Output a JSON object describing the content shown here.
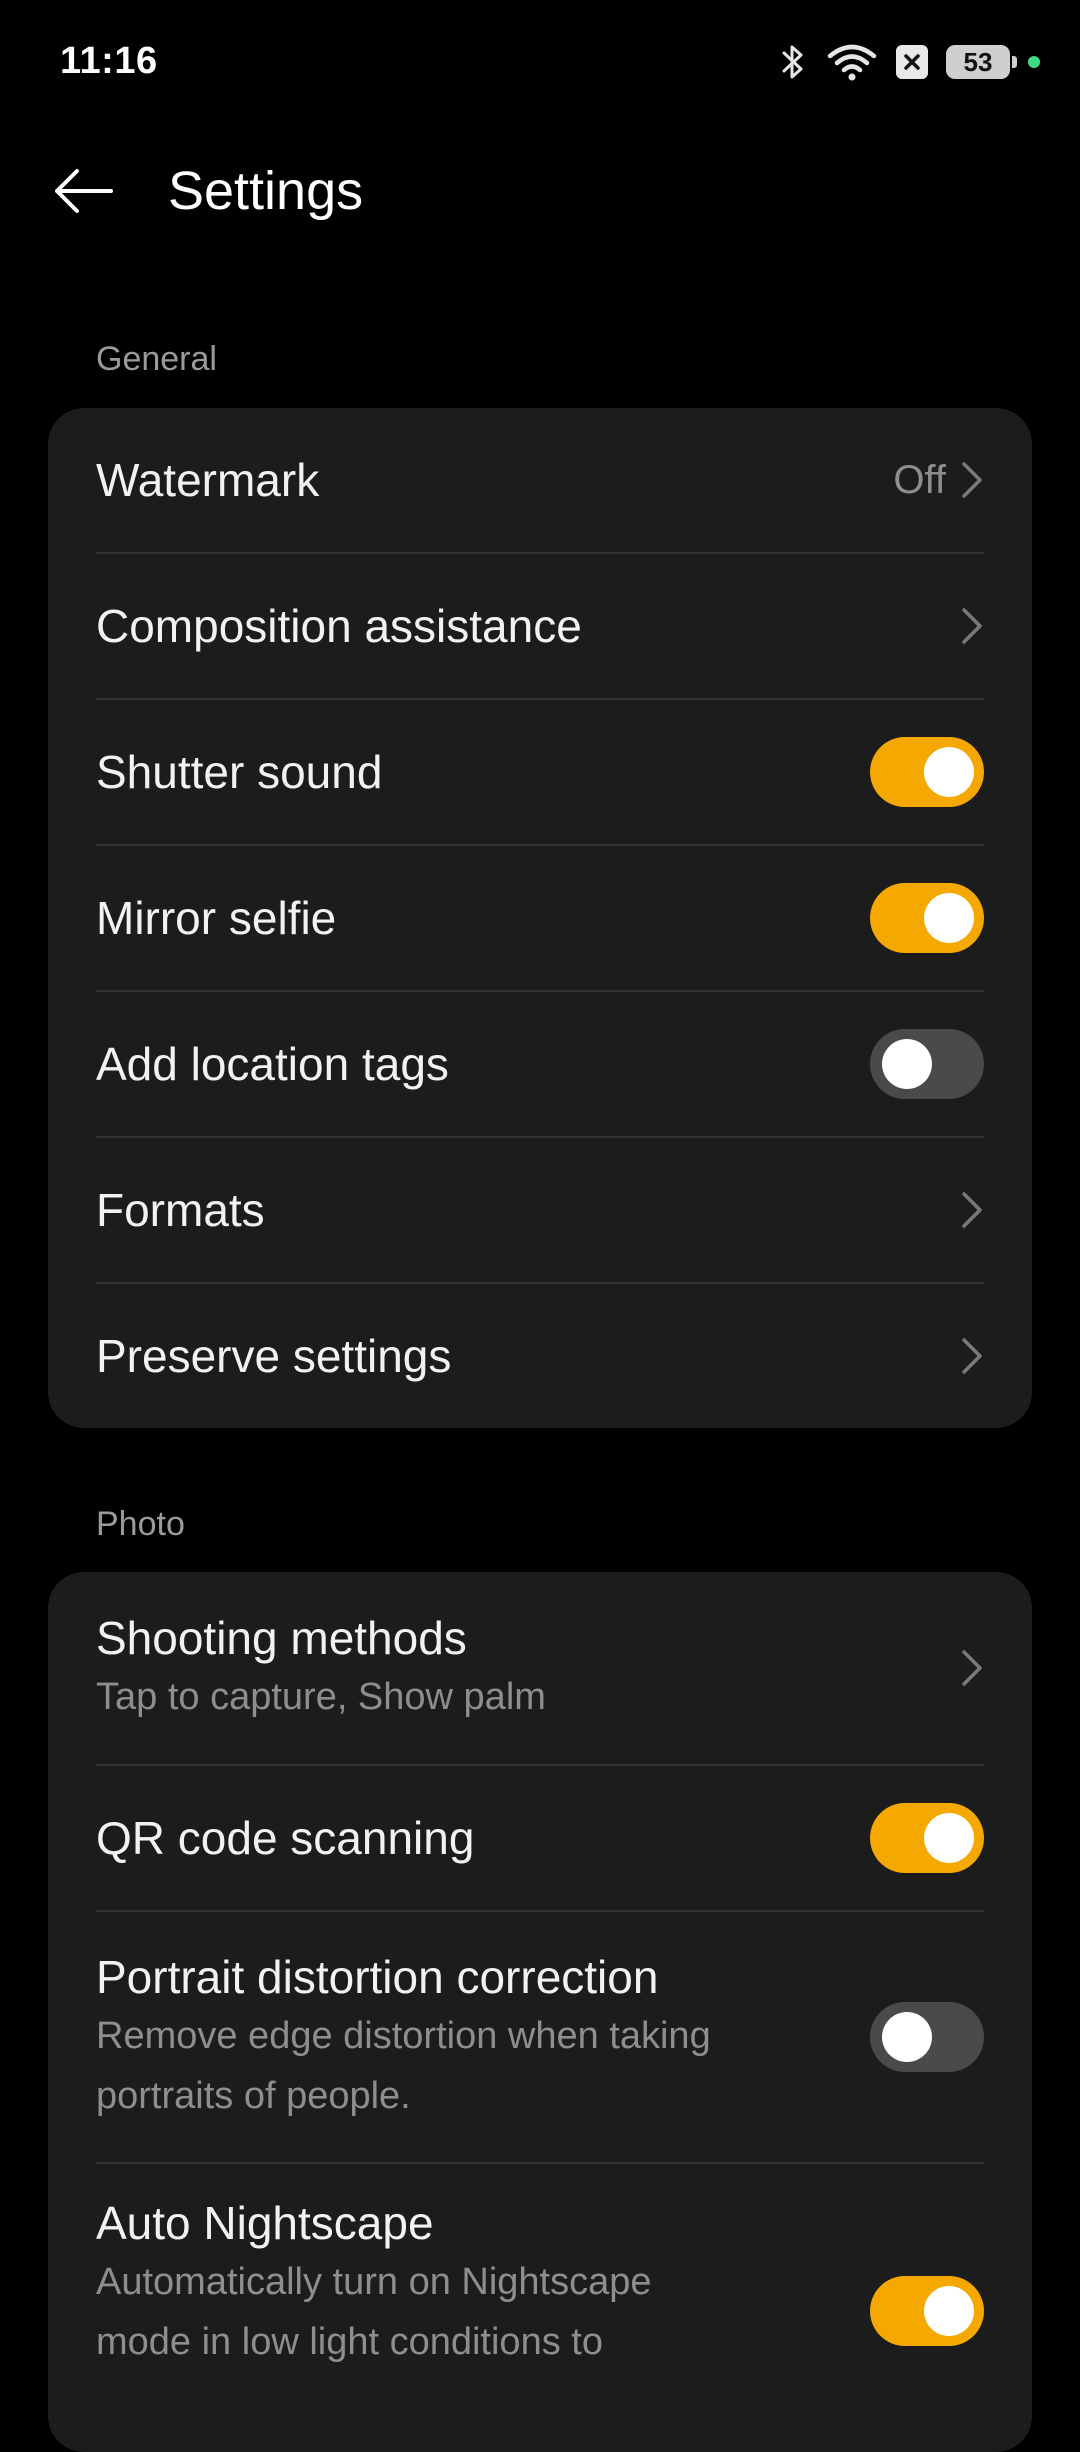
{
  "status_bar": {
    "time": "11:16",
    "battery": "53",
    "icons": [
      "bluetooth-icon",
      "wifi-icon",
      "no-sim-icon",
      "battery-icon"
    ],
    "dot_color": "#3ddc84"
  },
  "header": {
    "title": "Settings",
    "back_icon": "back-arrow-icon"
  },
  "colors": {
    "accent": "#f5a800",
    "card_bg": "#1c1c1c",
    "toggle_off": "#4a4a4a"
  },
  "general": {
    "label": "General",
    "items": [
      {
        "title": "Watermark",
        "value": "Off",
        "control": "chevron"
      },
      {
        "title": "Composition assistance",
        "control": "chevron"
      },
      {
        "title": "Shutter sound",
        "control": "toggle",
        "on": true
      },
      {
        "title": "Mirror selfie",
        "control": "toggle",
        "on": true
      },
      {
        "title": "Add location tags",
        "control": "toggle",
        "on": false
      },
      {
        "title": "Formats",
        "control": "chevron"
      },
      {
        "title": "Preserve settings",
        "control": "chevron"
      }
    ]
  },
  "photo": {
    "label": "Photo",
    "items": [
      {
        "title": "Shooting methods",
        "subtitle": "Tap to capture, Show palm",
        "control": "chevron"
      },
      {
        "title": "QR code scanning",
        "control": "toggle",
        "on": true
      },
      {
        "title": "Portrait distortion correction",
        "subtitle_lines": [
          "Remove edge distortion when taking",
          "portraits of people."
        ],
        "control": "toggle",
        "on": false
      },
      {
        "title": "Auto Nightscape",
        "subtitle_lines": [
          "Automatically turn on Nightscape",
          "mode in low light conditions to"
        ],
        "control": "toggle",
        "on": true
      }
    ]
  }
}
